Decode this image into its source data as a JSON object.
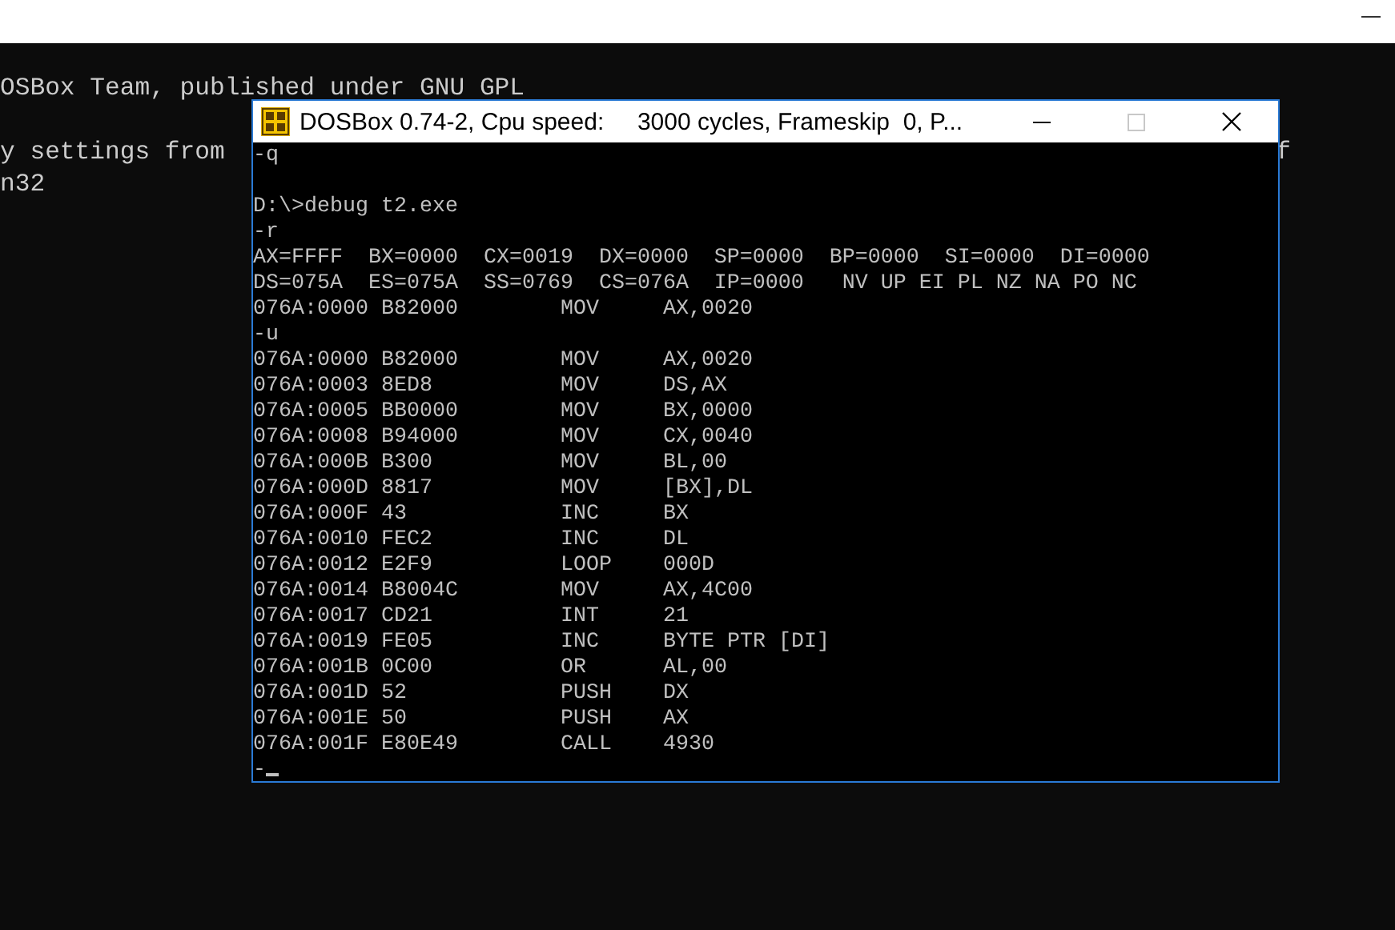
{
  "background_console": {
    "lines": [
      {
        "segments": [
          "OSBox Team, published under GNU GPL"
        ]
      },
      {
        "kind": "blank"
      },
      {
        "segments": [
          "y settings from ",
          "f"
        ]
      },
      {
        "segments": [
          "n32"
        ]
      }
    ]
  },
  "window": {
    "title": "DOSBox 0.74-2, Cpu speed:     3000 cycles, Frameskip  0, P...",
    "maximize_disabled": true,
    "lines": [
      {
        "kind": "text",
        "text": "-q"
      },
      {
        "kind": "blank"
      },
      {
        "kind": "text",
        "text": "D:\\>debug t2.exe"
      },
      {
        "kind": "text",
        "text": "-r"
      },
      {
        "kind": "text",
        "text": "AX=FFFF  BX=0000  CX=0019  DX=0000  SP=0000  BP=0000  SI=0000  DI=0000"
      },
      {
        "kind": "text",
        "text": "DS=075A  ES=075A  SS=0769  CS=076A  IP=0000   NV UP EI PL NZ NA PO NC"
      },
      {
        "kind": "instruction",
        "address": "076A:0000",
        "bytes": "B82000",
        "mnemonic": "MOV",
        "operands": "AX,0020"
      },
      {
        "kind": "text",
        "text": "-u"
      },
      {
        "kind": "instruction",
        "address": "076A:0000",
        "bytes": "B82000",
        "mnemonic": "MOV",
        "operands": "AX,0020"
      },
      {
        "kind": "instruction",
        "address": "076A:0003",
        "bytes": "8ED8",
        "mnemonic": "MOV",
        "operands": "DS,AX"
      },
      {
        "kind": "instruction",
        "address": "076A:0005",
        "bytes": "BB0000",
        "mnemonic": "MOV",
        "operands": "BX,0000"
      },
      {
        "kind": "instruction",
        "address": "076A:0008",
        "bytes": "B94000",
        "mnemonic": "MOV",
        "operands": "CX,0040"
      },
      {
        "kind": "instruction",
        "address": "076A:000B",
        "bytes": "B300",
        "mnemonic": "MOV",
        "operands": "BL,00"
      },
      {
        "kind": "instruction",
        "address": "076A:000D",
        "bytes": "8817",
        "mnemonic": "MOV",
        "operands": "[BX],DL"
      },
      {
        "kind": "instruction",
        "address": "076A:000F",
        "bytes": "43",
        "mnemonic": "INC",
        "operands": "BX"
      },
      {
        "kind": "instruction",
        "address": "076A:0010",
        "bytes": "FEC2",
        "mnemonic": "INC",
        "operands": "DL"
      },
      {
        "kind": "instruction",
        "address": "076A:0012",
        "bytes": "E2F9",
        "mnemonic": "LOOP",
        "operands": "000D"
      },
      {
        "kind": "instruction",
        "address": "076A:0014",
        "bytes": "B8004C",
        "mnemonic": "MOV",
        "operands": "AX,4C00"
      },
      {
        "kind": "instruction",
        "address": "076A:0017",
        "bytes": "CD21",
        "mnemonic": "INT",
        "operands": "21"
      },
      {
        "kind": "instruction",
        "address": "076A:0019",
        "bytes": "FE05",
        "mnemonic": "INC",
        "operands": "BYTE PTR [DI]"
      },
      {
        "kind": "instruction",
        "address": "076A:001B",
        "bytes": "0C00",
        "mnemonic": "OR",
        "operands": "AL,00"
      },
      {
        "kind": "instruction",
        "address": "076A:001D",
        "bytes": "52",
        "mnemonic": "PUSH",
        "operands": "DX"
      },
      {
        "kind": "instruction",
        "address": "076A:001E",
        "bytes": "50",
        "mnemonic": "PUSH",
        "operands": "AX"
      },
      {
        "kind": "instruction",
        "address": "076A:001F",
        "bytes": "E80E49",
        "mnemonic": "CALL",
        "operands": "4930"
      },
      {
        "kind": "prompt",
        "text": "-"
      }
    ]
  }
}
